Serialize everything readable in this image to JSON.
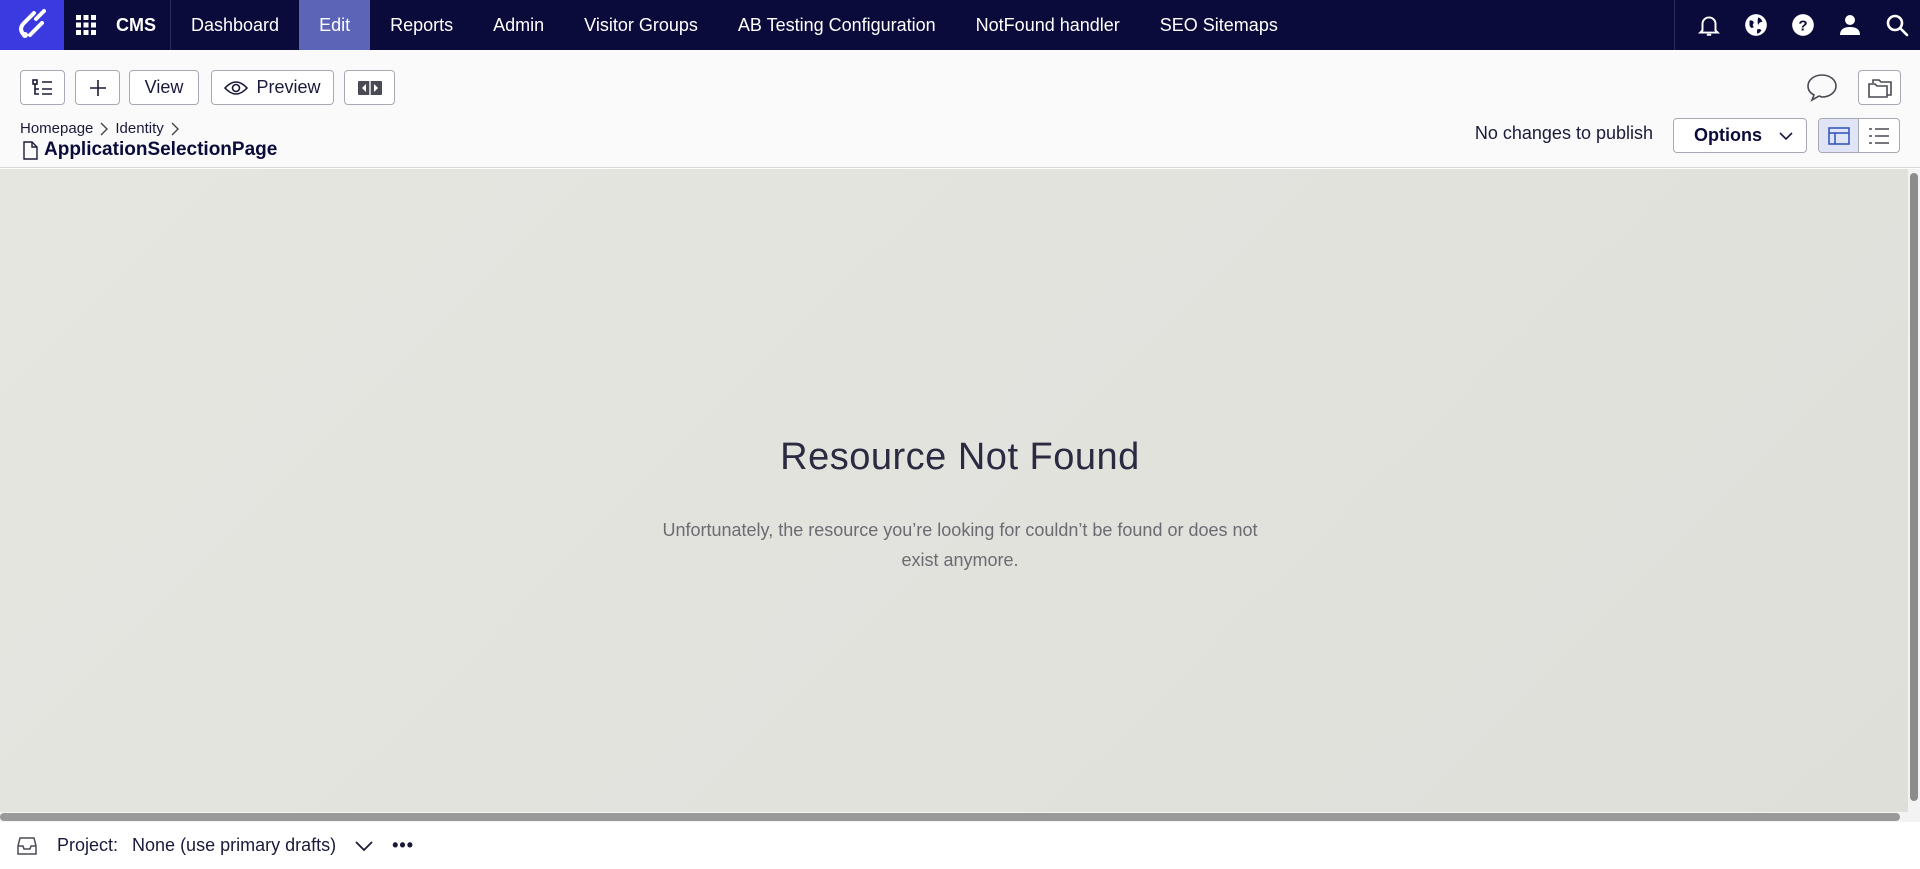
{
  "app": {
    "name": "CMS"
  },
  "topnav": {
    "items": [
      {
        "label": "Dashboard",
        "active": false
      },
      {
        "label": "Edit",
        "active": true
      },
      {
        "label": "Reports",
        "active": false
      },
      {
        "label": "Admin",
        "active": false
      },
      {
        "label": "Visitor Groups",
        "active": false
      },
      {
        "label": "AB Testing Configuration",
        "active": false
      },
      {
        "label": "NotFound handler",
        "active": false
      },
      {
        "label": "SEO Sitemaps",
        "active": false
      }
    ],
    "right_icons": [
      "bell-icon",
      "globe-icon",
      "help-icon",
      "user-icon",
      "search-icon"
    ]
  },
  "toolbar": {
    "view_label": "View",
    "preview_label": "Preview",
    "publish_status": "No changes to publish",
    "options_label": "Options"
  },
  "breadcrumb": {
    "items": [
      "Homepage",
      "Identity"
    ],
    "page_title": "ApplicationSelectionPage"
  },
  "content": {
    "title": "Resource Not Found",
    "message": "Unfortunately, the resource you’re looking for couldn’t be found or does not exist anymore."
  },
  "footer": {
    "project_label": "Project:",
    "project_value": "None (use primary drafts)",
    "more_label": "•••"
  },
  "colors": {
    "nav_bg": "#0b0b3b",
    "logo_bg": "#3a3ae0",
    "active_tab": "#5c64b8",
    "content_bg": "#e3e3de"
  }
}
